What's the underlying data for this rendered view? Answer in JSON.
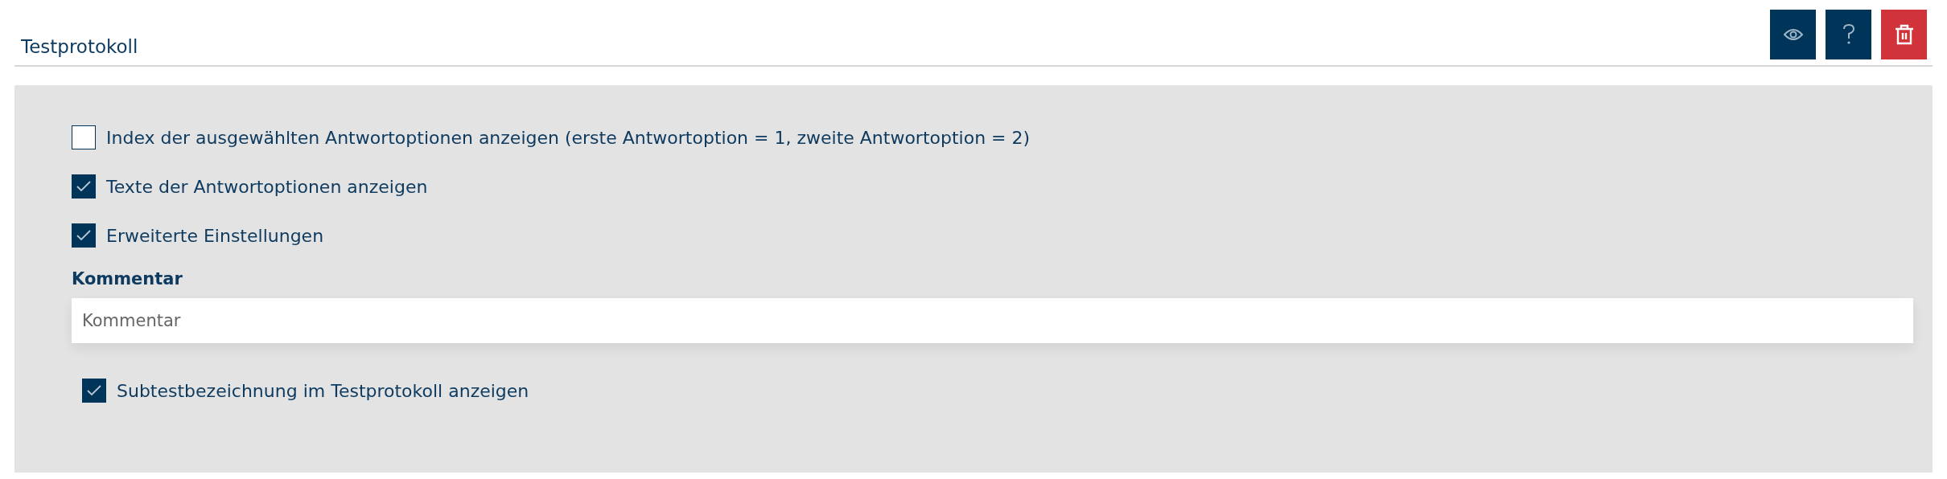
{
  "header": {
    "title": "Testprotokoll",
    "buttons": [
      {
        "kind": "preview"
      },
      {
        "kind": "help"
      },
      {
        "kind": "delete"
      }
    ]
  },
  "options": [
    {
      "label": "Index der ausgewählten Antwortoptionen anzeigen (erste Antwortoption = 1, zweite Antwortoption = 2)",
      "checked": false
    },
    {
      "label": "Texte der Antwortoptionen anzeigen",
      "checked": true
    },
    {
      "label": "Erweiterte Einstellungen",
      "checked": true
    }
  ],
  "comment": {
    "label": "Kommentar",
    "placeholder": "Kommentar"
  },
  "subtest_option": {
    "label": "Subtestbezeichnung im Testprotokoll anzeigen",
    "checked": true
  }
}
